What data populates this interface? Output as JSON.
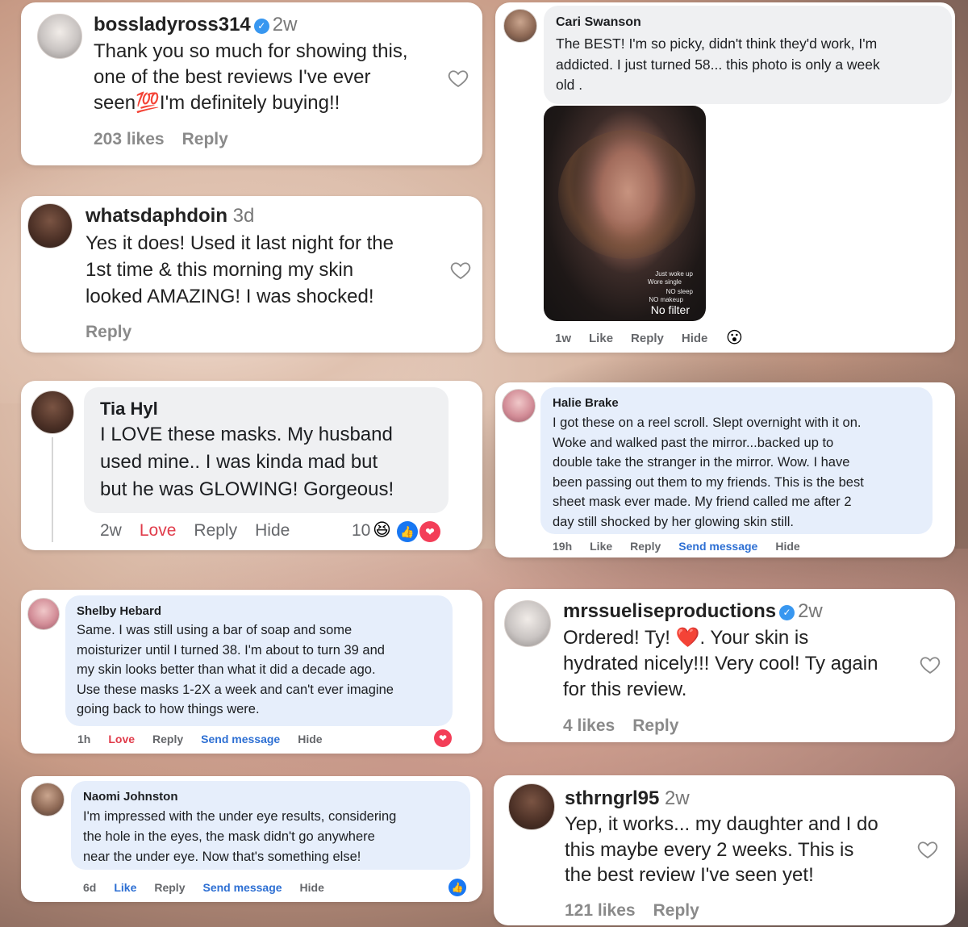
{
  "comments": {
    "c1": {
      "username": "bossladyross314",
      "time": "2w",
      "text_lines": [
        "Thank you so much for showing this,",
        "one of the best reviews I've ever",
        "seen💯I'm definitely buying!!"
      ],
      "likes": "203 likes",
      "reply": "Reply"
    },
    "c2": {
      "name": "Cari Swanson",
      "text_lines": [
        "The BEST! I'm so picky, didn't think they'd work, I'm",
        "addicted. I just turned 58... this photo is only a week",
        "old ."
      ],
      "photo_captions": [
        "Just woke up",
        "Wore single",
        "NO sleep",
        "NO makeup"
      ],
      "photo_label": "No filter",
      "time": "1w",
      "like": "Like",
      "reply": "Reply",
      "hide": "Hide",
      "reaction": "😮"
    },
    "c3": {
      "username": "whatsdaphdoin",
      "time": "3d",
      "text_lines": [
        "Yes it does! Used it last night for the",
        "1st time & this morning my skin",
        "looked AMAZING! I was shocked!"
      ],
      "reply": "Reply"
    },
    "c4": {
      "name": "Tia Hyl",
      "text_lines": [
        "I LOVE these masks. My husband",
        "used mine.. I was kinda mad but",
        "but he was GLOWING! Gorgeous!"
      ],
      "time": "2w",
      "love": "Love",
      "reply": "Reply",
      "hide": "Hide",
      "reaction_count": "10",
      "reactions": [
        "😆",
        "👍",
        "❤"
      ]
    },
    "c5": {
      "name": "Halie Brake",
      "text_lines": [
        "I got these on a reel scroll. Slept overnight with it on.",
        "Woke and walked past the mirror...backed up to",
        "double take the stranger in the mirror. Wow. I have",
        "been passing out them to my friends. This is the best",
        "sheet mask ever made. My friend called me after 2",
        "day still shocked by her glowing skin still."
      ],
      "time": "19h",
      "like": "Like",
      "reply": "Reply",
      "send_message": "Send message",
      "hide": "Hide"
    },
    "c6": {
      "name": "Shelby Hebard",
      "text_lines": [
        "Same. I was still using a bar of soap and some",
        "moisturizer until I turned 38. I'm about to turn 39 and",
        "my skin looks better than what it did a decade ago.",
        "Use these masks 1-2X a week and can't ever imagine",
        "going back to how things were."
      ],
      "time": "1h",
      "love": "Love",
      "reply": "Reply",
      "send_message": "Send message",
      "hide": "Hide",
      "reaction": "❤"
    },
    "c7": {
      "username": "mrssueliseproductions",
      "time": "2w",
      "text_lines": [
        "Ordered! Ty! ❤️. Your skin is",
        "hydrated nicely!!! Very cool! Ty again",
        "for this review."
      ],
      "likes": "4 likes",
      "reply": "Reply"
    },
    "c8": {
      "name": "Naomi Johnston",
      "text_lines": [
        "I'm impressed with the under eye results, considering",
        "the hole in the eyes, the mask didn't go anywhere",
        "near the under eye. Now that's something else!"
      ],
      "time": "6d",
      "like": "Like",
      "reply": "Reply",
      "send_message": "Send message",
      "hide": "Hide",
      "reaction": "👍"
    },
    "c9": {
      "username": "sthrngrl95",
      "time": "2w",
      "text_lines": [
        "Yep, it works... my daughter and I do",
        "this maybe every 2 weeks. This is",
        "the best review I've seen yet!"
      ],
      "likes": "121 likes",
      "reply": "Reply"
    }
  },
  "colors": {
    "ig_verified": "#3897f0",
    "fb_blue_link": "#2d6fd3",
    "fb_love_red": "#e03b4a",
    "bubble_grey": "#eff0f2",
    "bubble_blue": "#e6eefb"
  },
  "icons": {
    "verified": "✓",
    "heart_outline": "heart-outline-icon"
  }
}
